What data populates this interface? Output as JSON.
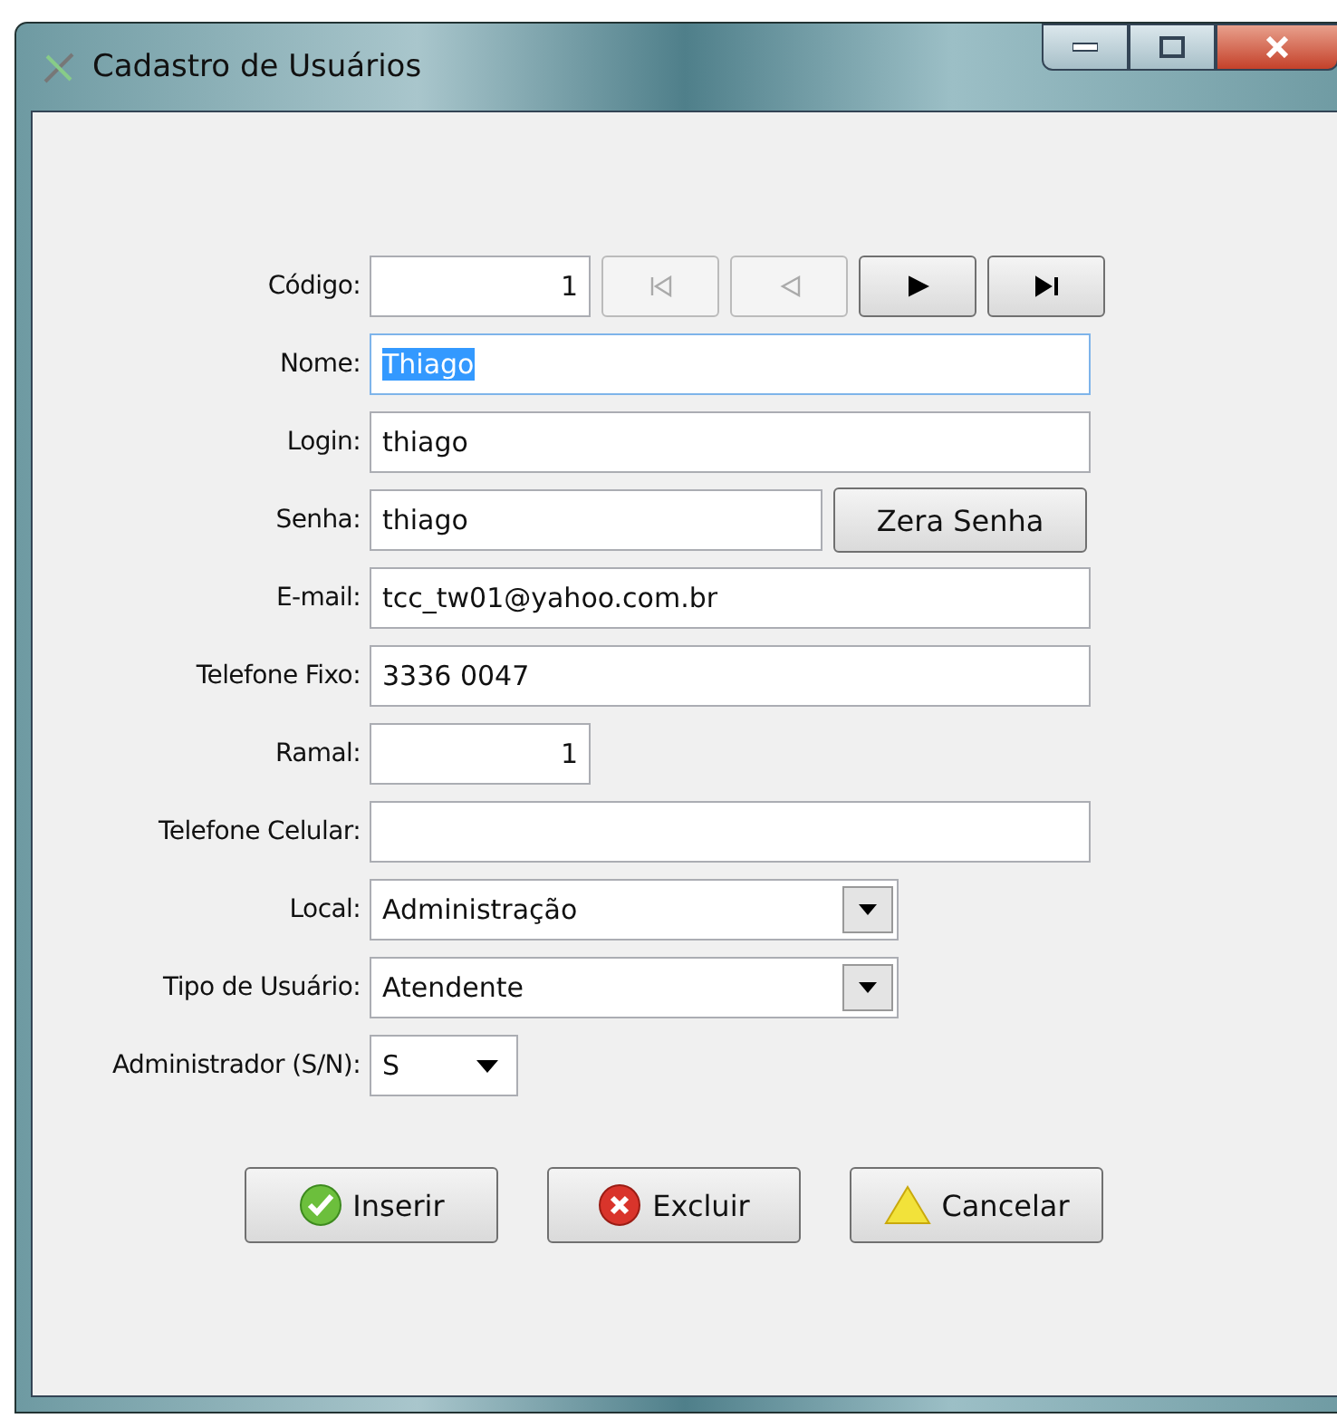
{
  "window": {
    "title": "Cadastro de Usuários"
  },
  "fields": [
    {
      "label": "Código:",
      "kind": "number",
      "value": "1",
      "nav_buttons": [
        {
          "kind": "first",
          "disabled": true
        },
        {
          "kind": "prev",
          "disabled": true
        },
        {
          "kind": "next",
          "disabled": false
        },
        {
          "kind": "last",
          "disabled": false
        }
      ]
    },
    {
      "label": "Nome:",
      "kind": "text",
      "value": "Thiago",
      "value_selected": true
    },
    {
      "label": "Login:",
      "kind": "text",
      "value": "thiago"
    },
    {
      "label": "Senha:",
      "kind": "text-button",
      "value": "thiago",
      "button": "Zera Senha"
    },
    {
      "label": "E-mail:",
      "kind": "text",
      "value": "tcc_tw01@yahoo.com.br"
    },
    {
      "label": "Telefone Fixo:",
      "kind": "text",
      "value": "3336 0047"
    },
    {
      "label": "Ramal:",
      "kind": "number",
      "value": "1"
    },
    {
      "label": "Telefone Celular:",
      "kind": "text"
    },
    {
      "label": "Local:",
      "kind": "combo",
      "value": "Administração"
    },
    {
      "label": "Tipo de Usuário:",
      "kind": "combo",
      "value": "Atendente"
    },
    {
      "label": "Administrador (S/N):",
      "kind": "dropdown",
      "value": "S"
    }
  ],
  "buttons": [
    {
      "label": "Inserir",
      "kind": "ok"
    },
    {
      "label": "Excluir",
      "kind": "delete"
    },
    {
      "label": "Cancelar",
      "kind": "cancel"
    }
  ]
}
